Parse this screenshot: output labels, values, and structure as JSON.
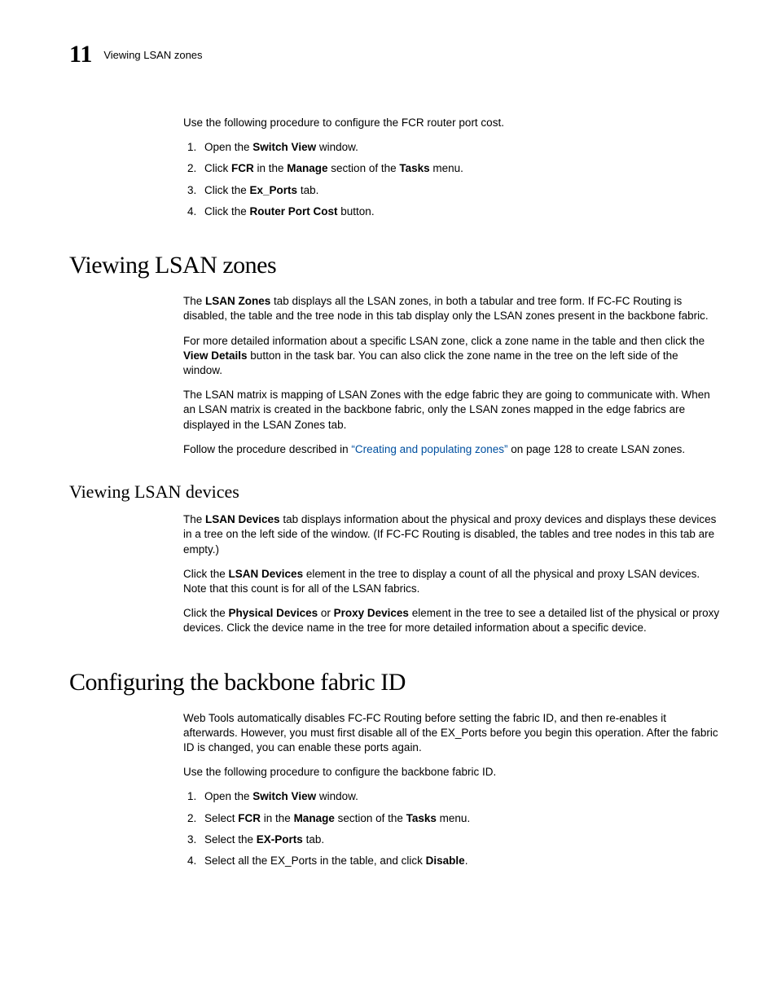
{
  "header": {
    "chapter_number": "11",
    "running_title": "Viewing LSAN zones"
  },
  "intro": {
    "lead": "Use the following procedure to configure the FCR router port cost.",
    "steps": {
      "s1_a": "Open the ",
      "s1_b": "Switch View",
      "s1_c": " window.",
      "s2_a": "Click ",
      "s2_b": "FCR",
      "s2_c": " in the ",
      "s2_d": "Manage",
      "s2_e": " section of the ",
      "s2_f": "Tasks",
      "s2_g": " menu.",
      "s3_a": "Click the ",
      "s3_b": "Ex_Ports",
      "s3_c": " tab.",
      "s4_a": "Click the ",
      "s4_b": "Router Port Cost",
      "s4_c": " button."
    }
  },
  "section1": {
    "heading": "Viewing LSAN zones",
    "p1_a": "The ",
    "p1_b": "LSAN Zones",
    "p1_c": " tab displays all the LSAN zones, in both a tabular and tree form. If FC-FC Routing is disabled, the table and the tree node in this tab display only the LSAN zones present in the backbone fabric.",
    "p2_a": "For more detailed information about a specific LSAN zone, click a zone name in the table and then click the ",
    "p2_b": "View Details",
    "p2_c": " button in the task bar. You can also click the zone name in the tree on the left side of the window.",
    "p3": "The LSAN matrix is mapping of LSAN Zones with the edge fabric they are going to communicate with. When an LSAN matrix is created in the backbone fabric, only the LSAN zones mapped in the edge fabrics are displayed in the LSAN Zones tab.",
    "p4_a": "Follow the procedure described in ",
    "p4_link": "“Creating and populating zones”",
    "p4_b": " on page 128 to create LSAN zones."
  },
  "subsection1": {
    "heading": "Viewing LSAN devices",
    "p1_a": "The ",
    "p1_b": "LSAN Devices",
    "p1_c": " tab displays information about the physical and proxy devices and displays these devices in a tree on the left side of the window. (If FC-FC Routing is disabled, the tables and tree nodes in this tab are empty.)",
    "p2_a": "Click the ",
    "p2_b": "LSAN Devices",
    "p2_c": " element in the tree to display a count of all the physical and proxy LSAN devices. Note that this count is for all of the LSAN fabrics.",
    "p3_a": "Click the ",
    "p3_b": "Physical Devices",
    "p3_c": " or ",
    "p3_d": "Proxy Devices",
    "p3_e": " element in the tree to see a detailed list of the physical or proxy devices. Click the device name in the tree for more detailed information about a specific device."
  },
  "section2": {
    "heading": "Configuring the backbone fabric ID",
    "p1": "Web Tools automatically disables FC-FC Routing before setting the fabric ID, and then re-enables it afterwards. However, you must first disable all of the EX_Ports before you begin this operation. After the fabric ID is changed, you can enable these ports again.",
    "p2": "Use the following procedure to configure the backbone fabric ID.",
    "steps": {
      "s1_a": "Open the ",
      "s1_b": "Switch View",
      "s1_c": " window.",
      "s2_a": "Select ",
      "s2_b": "FCR",
      "s2_c": " in the ",
      "s2_d": "Manage",
      "s2_e": " section of the ",
      "s2_f": "Tasks",
      "s2_g": " menu.",
      "s3_a": "Select the ",
      "s3_b": "EX-Ports",
      "s3_c": " tab.",
      "s4_a": "Select all the EX_Ports in the table, and click ",
      "s4_b": "Disable",
      "s4_c": "."
    }
  }
}
